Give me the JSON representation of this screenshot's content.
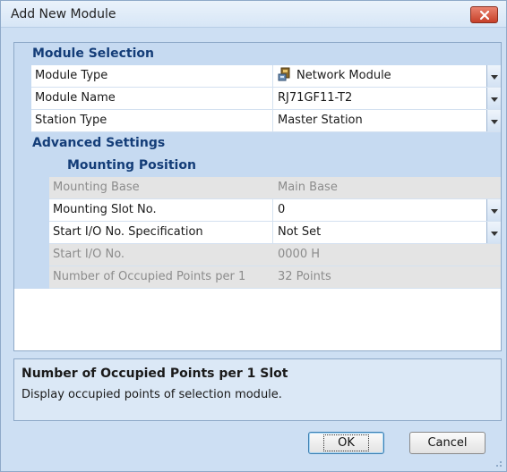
{
  "window": {
    "title": "Add New Module",
    "close_icon": "close-x-icon"
  },
  "colors": {
    "band": "#c6daf1",
    "band_text": "#143d78",
    "disabled_row": "#e4e4e4",
    "close_button": "#c7402a"
  },
  "sections": {
    "module_selection": "Module Selection",
    "advanced_settings": "Advanced Settings",
    "mounting_position": "Mounting Position"
  },
  "module_selection": {
    "module_type": {
      "label": "Module Type",
      "value": "Network Module",
      "icon": "network-module-icon"
    },
    "module_name": {
      "label": "Module Name",
      "value": "RJ71GF11-T2"
    },
    "station_type": {
      "label": "Station Type",
      "value": "Master Station"
    }
  },
  "mounting_position": {
    "mounting_base": {
      "label": "Mounting Base",
      "value": "Main Base"
    },
    "mounting_slot": {
      "label": "Mounting Slot No.",
      "value": "0"
    },
    "start_io_spec": {
      "label": "Start I/O No. Specification",
      "value": "Not Set"
    },
    "start_io": {
      "label": "Start I/O No.",
      "value": "0000 H"
    },
    "occupied_points": {
      "label": "Number of Occupied Points per 1",
      "value": "32 Points"
    }
  },
  "description": {
    "title": "Number of Occupied Points per 1 Slot",
    "text": "Display occupied points of selection module."
  },
  "buttons": {
    "ok": "OK",
    "cancel": "Cancel"
  }
}
